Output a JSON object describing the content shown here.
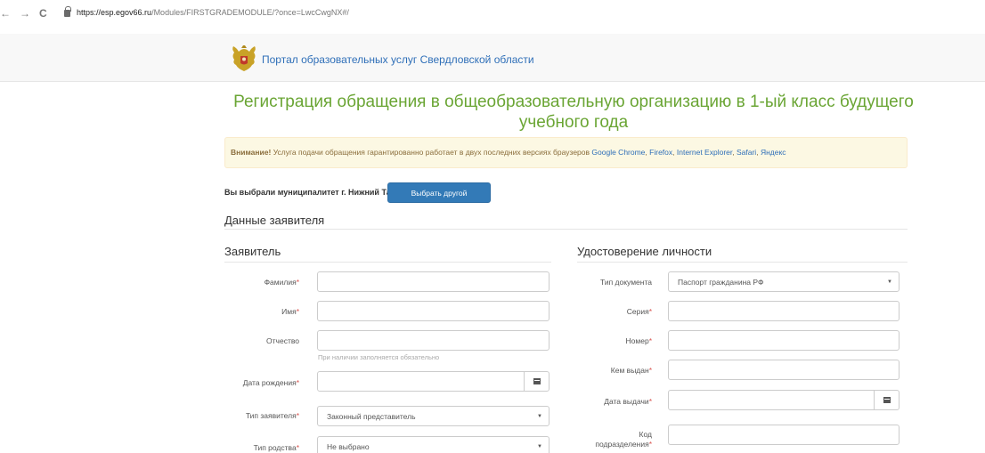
{
  "browser": {
    "back": "←",
    "forward": "→",
    "reload": "C",
    "url_host": "https://esp.egov66.ru",
    "url_path": "/Modules/FIRSTGRADEMODULE/?once=LwcCwgNX#/"
  },
  "header": {
    "portal_title": "Портал образовательных услуг Свердловской области",
    "emblem_icon": "coat-of-arms-icon"
  },
  "page": {
    "title": "Регистрация обращения в общеобразовательную организацию в 1-ый класс будущего учебного года"
  },
  "alert": {
    "strong": "Внимание!",
    "text": " Услуга подачи обращения гарантированно работает в двух последних версиях браузеров ",
    "links": [
      "Google Chrome",
      "Firefox",
      "Internet Explorer",
      "Safari",
      "Яндекс"
    ]
  },
  "municipality": {
    "text": "Вы выбрали муниципалитет г. Нижний Тагил",
    "change_button": "Выбрать другой"
  },
  "sections": {
    "applicant_data": "Данные заявителя",
    "applicant": "Заявитель",
    "identity": "Удостоверение личности"
  },
  "applicant_form": {
    "last_name": "Фамилия",
    "first_name": "Имя",
    "patronymic": "Отчество",
    "patronymic_help": "При наличии заполняется обязательно",
    "birth_date": "Дата рождения",
    "applicant_type": "Тип заявителя",
    "applicant_type_value": "Законный представитель",
    "relation_type": "Тип родства",
    "relation_type_value": "Не выбрано"
  },
  "identity_form": {
    "doc_type": "Тип документа",
    "doc_type_value": "Паспорт гражданина РФ",
    "series": "Серия",
    "number": "Номер",
    "issued_by": "Кем выдан",
    "issue_date": "Дата выдачи",
    "division_code_1": "Код",
    "division_code_2": "подразделения"
  },
  "colors": {
    "title_green": "#6aa534",
    "link_blue": "#2f6fb8",
    "button_blue": "#337ab7",
    "alert_bg": "#fcf8e3",
    "required_red": "#d9534f"
  }
}
